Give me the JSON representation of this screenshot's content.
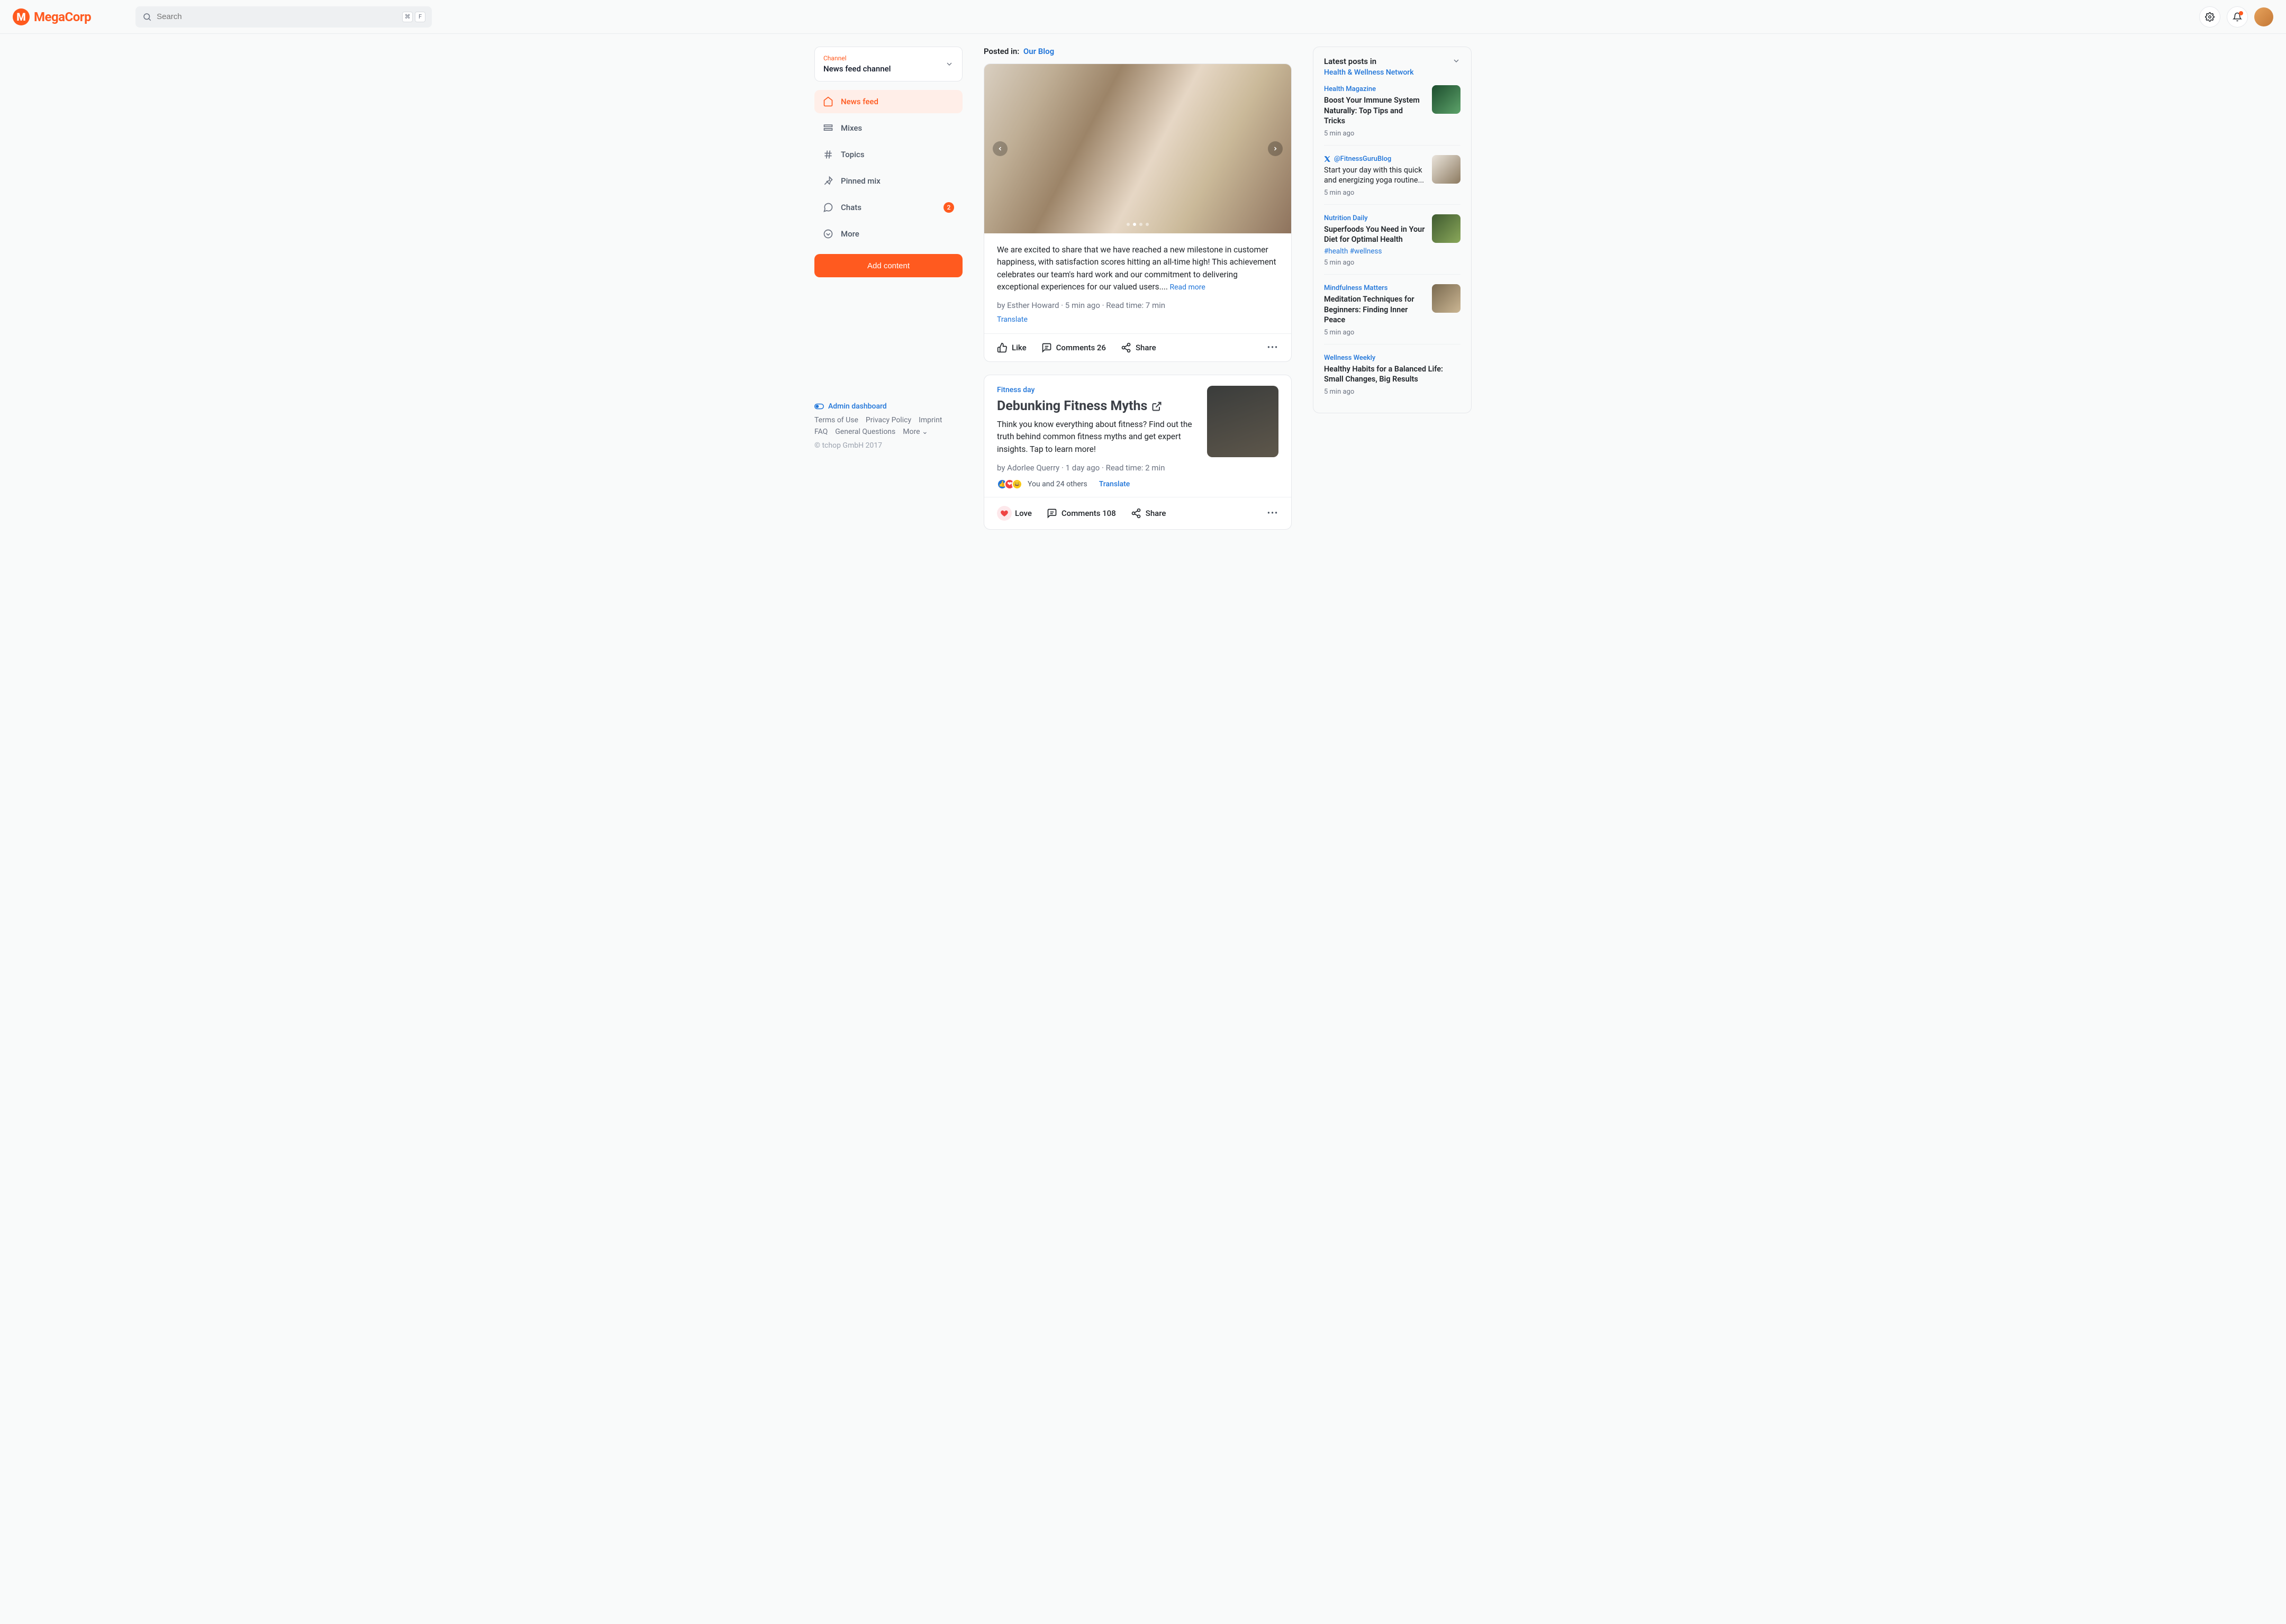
{
  "brand": {
    "name": "MegaCorp",
    "mark": "M"
  },
  "search": {
    "placeholder": "Search",
    "kbd1": "⌘",
    "kbd2": "F"
  },
  "sidebar": {
    "channel_label": "Channel",
    "channel_name": "News feed channel",
    "items": [
      {
        "label": "News feed",
        "active": true
      },
      {
        "label": "Mixes"
      },
      {
        "label": "Topics"
      },
      {
        "label": "Pinned mix"
      },
      {
        "label": "Chats",
        "badge": "2"
      },
      {
        "label": "More"
      }
    ],
    "add_button": "Add content",
    "admin_link": "Admin dashboard",
    "footer_links": [
      "Terms of Use",
      "Privacy Policy",
      "Imprint",
      "FAQ",
      "General Questions",
      "More"
    ],
    "copyright": "© tchop GmbH 2017"
  },
  "feed": {
    "posted_in_label": "Posted in:",
    "posted_in_link": "Our Blog",
    "post1": {
      "text": "We are excited to share that we have reached a new milestone in customer happiness, with satisfaction scores hitting an all-time high! This achievement celebrates our team's hard work and our commitment to delivering exceptional experiences for our valued users....",
      "read_more": "Read more",
      "byline": "by Esther Howard · 5 min ago · Read time: 7 min",
      "translate": "Translate",
      "like": "Like",
      "comments": "Comments 26",
      "share": "Share"
    },
    "post2": {
      "category": "Fitness day",
      "title": "Debunking Fitness Myths",
      "excerpt": "Think you know everything about fitness? Find out the truth behind common fitness myths and get expert insights. Tap to learn more!",
      "byline": "by Adorlee Querry · 1 day ago · Read time: 2 min",
      "reactions_text": "You and 24 others",
      "translate": "Translate",
      "love": "Love",
      "comments": "Comments 108",
      "share": "Share"
    }
  },
  "right": {
    "heading": "Latest posts in",
    "sub": "Health & Wellness Network",
    "items": [
      {
        "source": "Health Magazine",
        "title": "Boost Your Immune System Naturally: Top Tips and Tricks",
        "time": "5 min ago"
      },
      {
        "source": "@FitnessGuruBlog",
        "title": "Start your day with this quick and energizing yoga routine...",
        "time": "5 min ago",
        "x": true,
        "regular": true
      },
      {
        "source": "Nutrition Daily",
        "title": "Superfoods You Need in Your Diet for Optimal Health",
        "tags": "#health #wellness",
        "time": "5 min ago"
      },
      {
        "source": "Mindfulness Matters",
        "title": "Meditation Techniques for Beginners: Finding Inner Peace",
        "time": "5 min ago"
      },
      {
        "source": "Wellness Weekly",
        "title": "Healthy Habits for a Balanced Life: Small Changes, Big Results",
        "time": "5 min ago",
        "nothumb": true
      }
    ]
  }
}
